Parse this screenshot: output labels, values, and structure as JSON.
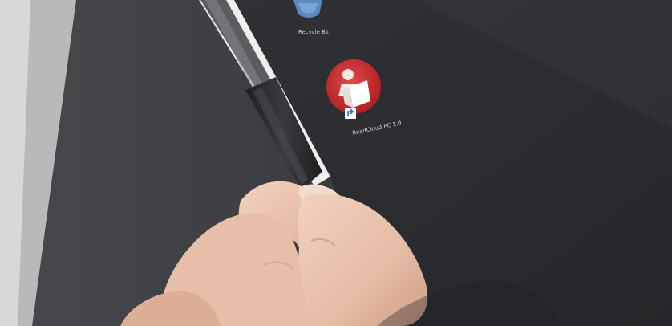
{
  "photo": {
    "description_tag": "hand-sliding-pen-on-tablet-edge",
    "colors": {
      "backdrop": "#e9e9ea",
      "frame": "#3b3b3e",
      "screen": "#2c2d30",
      "screen_edge": "#f2f2f2",
      "pen_body": "#2a2b2e",
      "skin": "#e9c3ae",
      "icon_red": "#c4282c",
      "icon_blue": "#4b7fb6"
    }
  },
  "desktop": {
    "icons": [
      {
        "name": "recycle-bin-icon",
        "label": "Recycle Bin"
      },
      {
        "name": "app-shortcut-icon",
        "label": "ReadCloud PC 1.0"
      }
    ]
  }
}
